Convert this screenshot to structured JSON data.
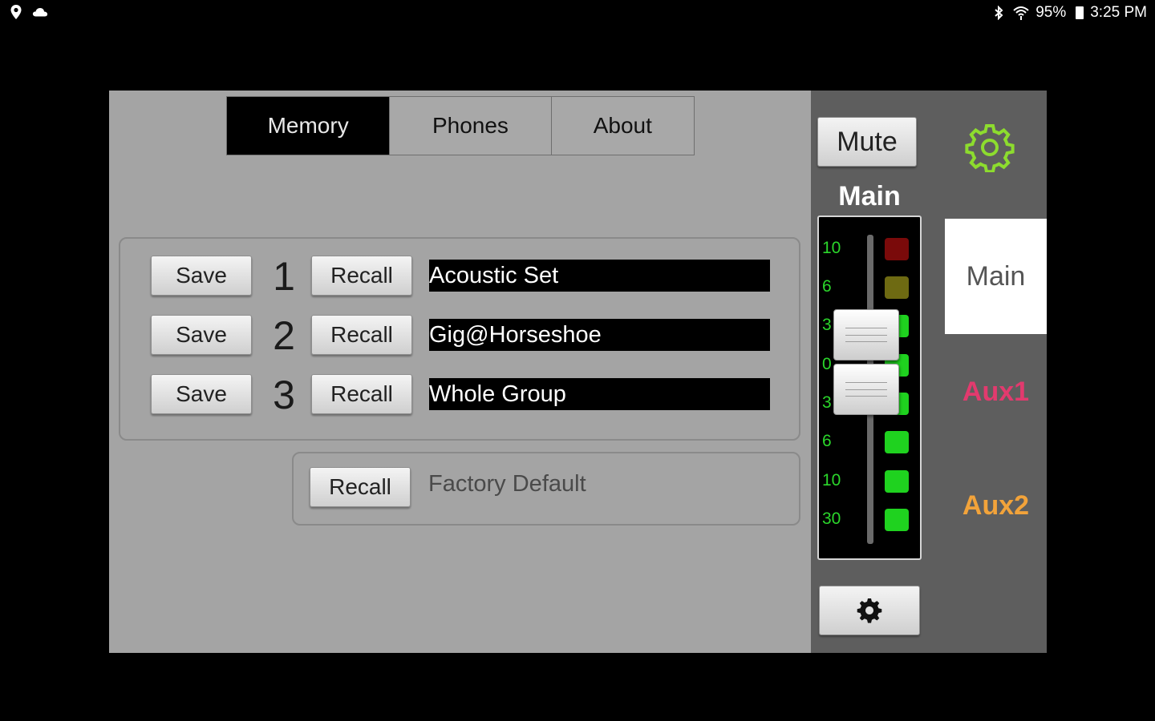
{
  "status_bar": {
    "battery": "95%",
    "time": "3:25 PM",
    "icons": [
      "location-icon",
      "cloud-icon",
      "bluetooth-icon",
      "wifi-icon",
      "battery-icon"
    ]
  },
  "tabs": [
    {
      "label": "Memory",
      "active": true
    },
    {
      "label": "Phones",
      "active": false
    },
    {
      "label": "About",
      "active": false
    }
  ],
  "memory": {
    "save_label": "Save",
    "recall_label": "Recall",
    "slots": [
      {
        "number": "1",
        "name": "Acoustic Set"
      },
      {
        "number": "2",
        "name": "Gig@Horseshoe"
      },
      {
        "number": "3",
        "name": "Whole Group"
      }
    ]
  },
  "factory": {
    "recall_label": "Recall",
    "label": "Factory Default"
  },
  "mixer": {
    "mute_label": "Mute",
    "channel_label": "Main",
    "scale": [
      "10",
      "6",
      "3",
      "0",
      "3",
      "6",
      "10",
      "30"
    ],
    "meter_colors": [
      "#7a0a0a",
      "#6e6a12",
      "#1fd21f",
      "#1fd21f",
      "#1fd21f",
      "#1fd21f",
      "#1fd21f",
      "#1fd21f"
    ],
    "accent_green": "#8ddc2e"
  },
  "bus_tabs": [
    {
      "label": "Main",
      "active": true,
      "color": "#555555"
    },
    {
      "label": "Aux1",
      "active": false,
      "color": "#e23a6e"
    },
    {
      "label": "Aux2",
      "active": false,
      "color": "#f2a33a"
    }
  ]
}
